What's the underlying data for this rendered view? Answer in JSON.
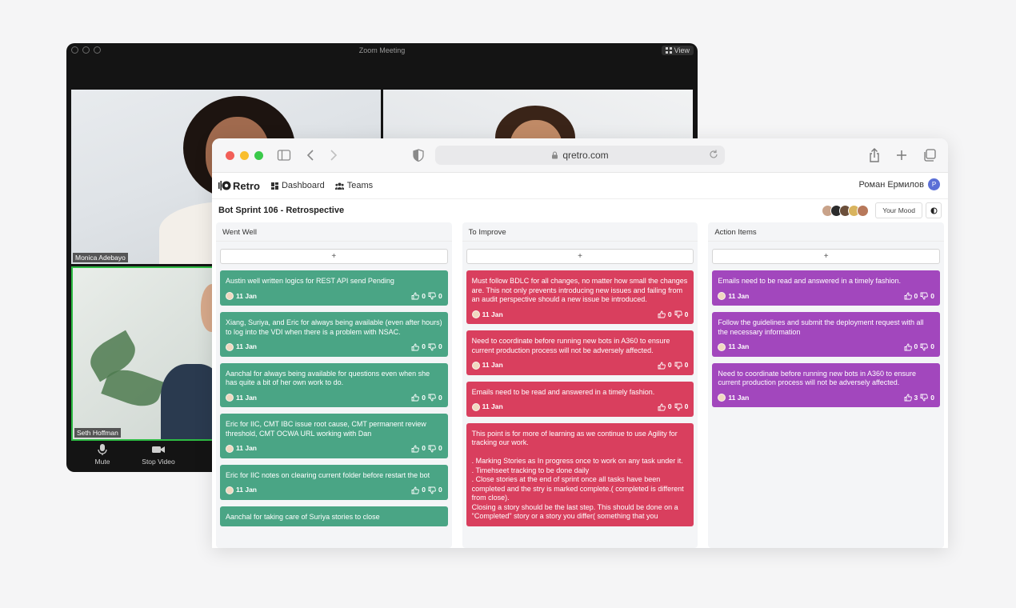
{
  "zoom": {
    "title": "Zoom Meeting",
    "view_label": "View",
    "participants": [
      "Monica Adebayo",
      "Seth Hoffman"
    ],
    "controls": [
      {
        "label": "Mute",
        "icon": "microphone-icon"
      },
      {
        "label": "Stop Video",
        "icon": "video-camera-icon"
      }
    ]
  },
  "browser": {
    "url": "qretro.com"
  },
  "app": {
    "logo": "Retro",
    "nav": [
      {
        "label": "Dashboard",
        "icon": "dashboard-icon"
      },
      {
        "label": "Teams",
        "icon": "teams-icon"
      }
    ],
    "user_name": "Роман Ермилов",
    "user_initial": "P"
  },
  "board": {
    "title": "Bot Sprint 106 - Retrospective",
    "mood_label": "Your Mood",
    "avatar_colors": [
      "#c9a38a",
      "#2b2b2b",
      "#6b4f3a",
      "#d9b45e",
      "#b7785a"
    ],
    "add_label": "+",
    "columns": [
      {
        "title": "Went Well",
        "color": "#4aa585",
        "cards": [
          {
            "text": "Austin well written logics for REST API send Pending",
            "date": "11 Jan",
            "likes": "0",
            "dislikes": "0"
          },
          {
            "text": "Xiang, Suriya, and Eric for always being available (even after hours) to log into the VDI when there is a problem with NSAC.",
            "date": "11 Jan",
            "likes": "0",
            "dislikes": "0"
          },
          {
            "text": "Aanchal for always being available for questions even when she has quite a bit of her own work to do.",
            "date": "11 Jan",
            "likes": "0",
            "dislikes": "0"
          },
          {
            "text": "Eric for IIC, CMT IBC issue root cause, CMT permanent review threshold, CMT OCWA URL working with Dan",
            "date": "11 Jan",
            "likes": "0",
            "dislikes": "0"
          },
          {
            "text": "Eric for IIC notes on clearing current folder before restart the bot",
            "date": "11 Jan",
            "likes": "0",
            "dislikes": "0"
          },
          {
            "text": "Aanchal for taking care of Suriya stories to close",
            "date": "",
            "likes": "",
            "dislikes": ""
          }
        ]
      },
      {
        "title": "To Improve",
        "color": "#d93f5e",
        "cards": [
          {
            "text": "Must follow BDLC for all changes, no matter how small the changes are. This not only prevents introducing new issues and failing from an audit perspective should a new issue be introduced.",
            "date": "11 Jan",
            "likes": "0",
            "dislikes": "0"
          },
          {
            "text": "Need to coordinate before running new bots in A360 to ensure current production process will not be adversely affected.",
            "date": "11 Jan",
            "likes": "0",
            "dislikes": "0"
          },
          {
            "text": "Emails need to be read and answered in a timely fashion.",
            "date": "11 Jan",
            "likes": "0",
            "dislikes": "0"
          },
          {
            "text": "This point is for more of learning as we continue to use Agility for tracking our work.\n\n. Marking Stories as In progress once to work on any task under it.\n. Timehseet tracking to be done daily\n. Close stories at the end of sprint once all tasks have been completed and the stry is marked complete.( completed is different from close).\nClosing a story should be the last step. This should be done on a \"Completed\" story or a story you differ( something that you",
            "date": "",
            "likes": "",
            "dislikes": ""
          }
        ]
      },
      {
        "title": "Action Items",
        "color": "#a247bd",
        "cards": [
          {
            "text": "Emails need to be read and answered in a timely fashion.",
            "date": "11 Jan",
            "likes": "0",
            "dislikes": "0"
          },
          {
            "text": "Follow the guidelines and submit the deployment request with all the necessary information",
            "date": "11 Jan",
            "likes": "0",
            "dislikes": "0"
          },
          {
            "text": "Need to coordinate before running new bots in A360 to ensure current production process will not be adversely affected.",
            "date": "11 Jan",
            "likes": "3",
            "dislikes": "0"
          }
        ]
      }
    ]
  }
}
